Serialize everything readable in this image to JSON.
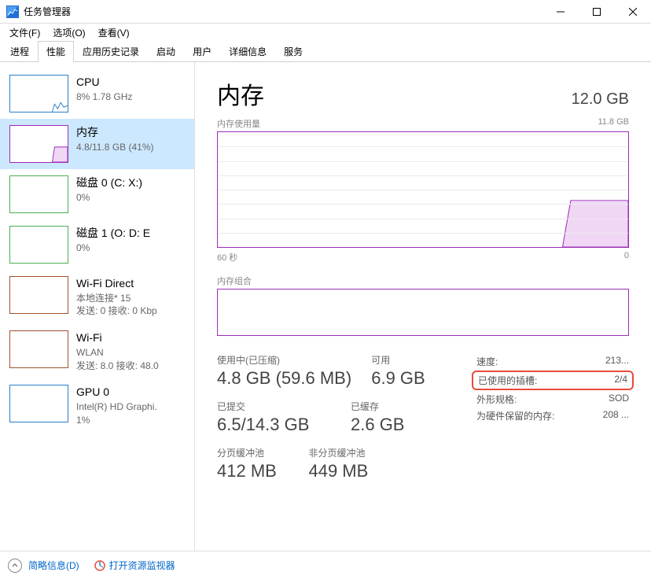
{
  "window": {
    "title": "任务管理器"
  },
  "menus": {
    "file": "文件(F)",
    "options": "选项(O)",
    "view": "查看(V)"
  },
  "tabs": {
    "processes": "进程",
    "performance": "性能",
    "appHistory": "应用历史记录",
    "startup": "启动",
    "users": "用户",
    "details": "详细信息",
    "services": "服务"
  },
  "sidebar": {
    "cpu": {
      "title": "CPU",
      "sub": "8%  1.78 GHz"
    },
    "memory": {
      "title": "内存",
      "sub": "4.8/11.8 GB (41%)"
    },
    "disk0": {
      "title": "磁盘 0 (C: X:)",
      "sub": "0%"
    },
    "disk1": {
      "title": "磁盘 1 (O: D: E",
      "sub": "0%"
    },
    "wifi1": {
      "title": "Wi-Fi Direct",
      "sub1": "本地连接* 15",
      "sub2": "发送: 0  接收: 0 Kbp"
    },
    "wifi2": {
      "title": "Wi-Fi",
      "sub1": "WLAN",
      "sub2": "发送: 8.0  接收: 48.0"
    },
    "gpu": {
      "title": "GPU 0",
      "sub1": "Intel(R) HD Graphi.",
      "sub2": "1%"
    }
  },
  "main": {
    "title": "内存",
    "total": "12.0 GB",
    "chart1_label": "内存使用量",
    "chart1_max": "11.8 GB",
    "chart1_axis_left": "60 秒",
    "chart1_axis_right": "0",
    "chart2_label": "内存组合",
    "inuse_label": "使用中(已压缩)",
    "inuse_value": "4.8 GB (59.6 MB)",
    "available_label": "可用",
    "available_value": "6.9 GB",
    "committed_label": "已提交",
    "committed_value": "6.5/14.3 GB",
    "cached_label": "已缓存",
    "cached_value": "2.6 GB",
    "paged_label": "分页缓冲池",
    "paged_value": "412 MB",
    "nonpaged_label": "非分页缓冲池",
    "nonpaged_value": "449 MB",
    "kv": {
      "speed_label": "速度:",
      "speed_value": "213...",
      "slots_label": "已使用的插槽:",
      "slots_value": "2/4",
      "form_label": "外形规格:",
      "form_value": "SOD",
      "reserved_label": "为硬件保留的内存:",
      "reserved_value": "208 ..."
    }
  },
  "statusbar": {
    "collapse": "简略信息(D)",
    "resmon": "打开资源监视器"
  },
  "chart_data": {
    "type": "area",
    "title": "内存使用量",
    "ylabel": "内存",
    "ylim": [
      0,
      11.8
    ],
    "xlim_seconds": [
      60,
      0
    ],
    "series": [
      {
        "name": "内存使用量 (GB)",
        "x_seconds": [
          60,
          55,
          50,
          45,
          40,
          35,
          30,
          25,
          20,
          15,
          10,
          5,
          0
        ],
        "values": [
          0,
          0,
          0,
          0,
          0,
          0,
          0,
          0,
          0,
          0,
          0,
          4.8,
          4.8
        ]
      }
    ]
  }
}
